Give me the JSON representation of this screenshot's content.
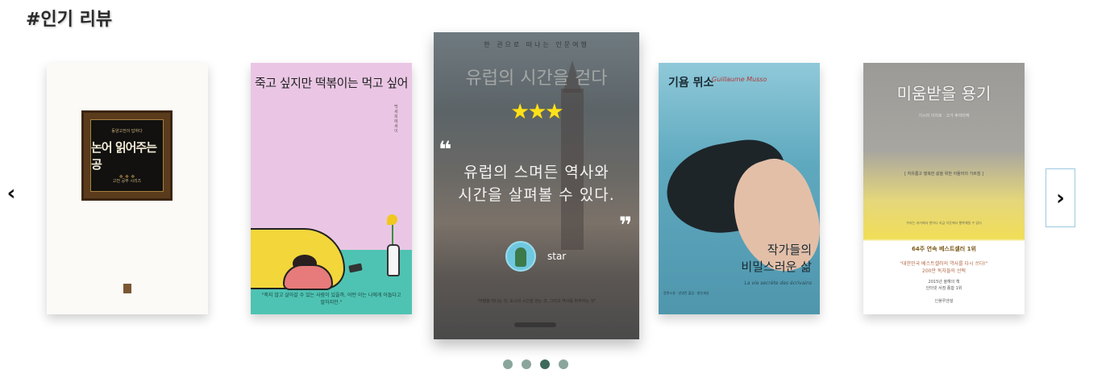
{
  "section": {
    "title": "#인기 리뷰"
  },
  "nav": {
    "prev_label": "‹",
    "next_label": "›"
  },
  "books": {
    "b1": {
      "series": "동양고전이 답하다",
      "title": "논어 읽어주는 공",
      "author": "고전 공부 시리즈"
    },
    "b2": {
      "title": "죽고 싶지만 떡볶이는 먹고 싶어",
      "author": "백세희 에세이",
      "quote": "\"죽지 않고 살아갈 수 있는 사람이 있을까, 어떤 이는 나에게 어둡다고 말하지만.\""
    },
    "b3": {
      "top_text": "한 권으로 떠나는 인문여행",
      "bg_title": "유럽의 시간을 걷다",
      "rating_stars": "★★★",
      "rating_value": 3,
      "review_line1": "유럽의 스며든 역사와",
      "review_line2": "시간을 살펴볼 수 있다.",
      "quote_open": "❝",
      "quote_close": "❞",
      "username": "star",
      "bottom_text": "\"여행을 떠나는 것, 도시의 시간을 걷는 것, 그리고 역사를 마주하는 것\""
    },
    "b4": {
      "title": "기욤 뮈소",
      "author_en": "Guillaume Musso",
      "subtitle_line1": "작가들의",
      "subtitle_line2": "비밀스러운 삶",
      "subtitle_en": "La vie secrète des écrivains",
      "note": "장편소설 · 양영란 옮김 · 밝은세상"
    },
    "b5": {
      "title": "미움받을 용기",
      "author": "기시미 이치로 · 고가 후미타케",
      "band": "[ 자유롭고 행복한 삶을 위한 아들러의 가르침 ]",
      "small": "우리는 과거에서 벗어나 지금 이곳에서 행복해질 수 있다",
      "badge": "64주 연속 베스트셀러 1위",
      "line1": "\"대한민국 베스트셀러의 역사를 다시 쓰다!\"",
      "line2": "200만 독자들의 선택",
      "line3": "2015년 올해의 책",
      "line4": "인터넷 서점 종합 1위",
      "publisher": "인플루엔셜"
    }
  },
  "pager": {
    "count": 4,
    "active_index": 2
  },
  "colors": {
    "star": "#ffe11a",
    "dot": "#8aa59b",
    "dot_active": "#3e6a5c",
    "next_border": "#9cc9e0"
  }
}
